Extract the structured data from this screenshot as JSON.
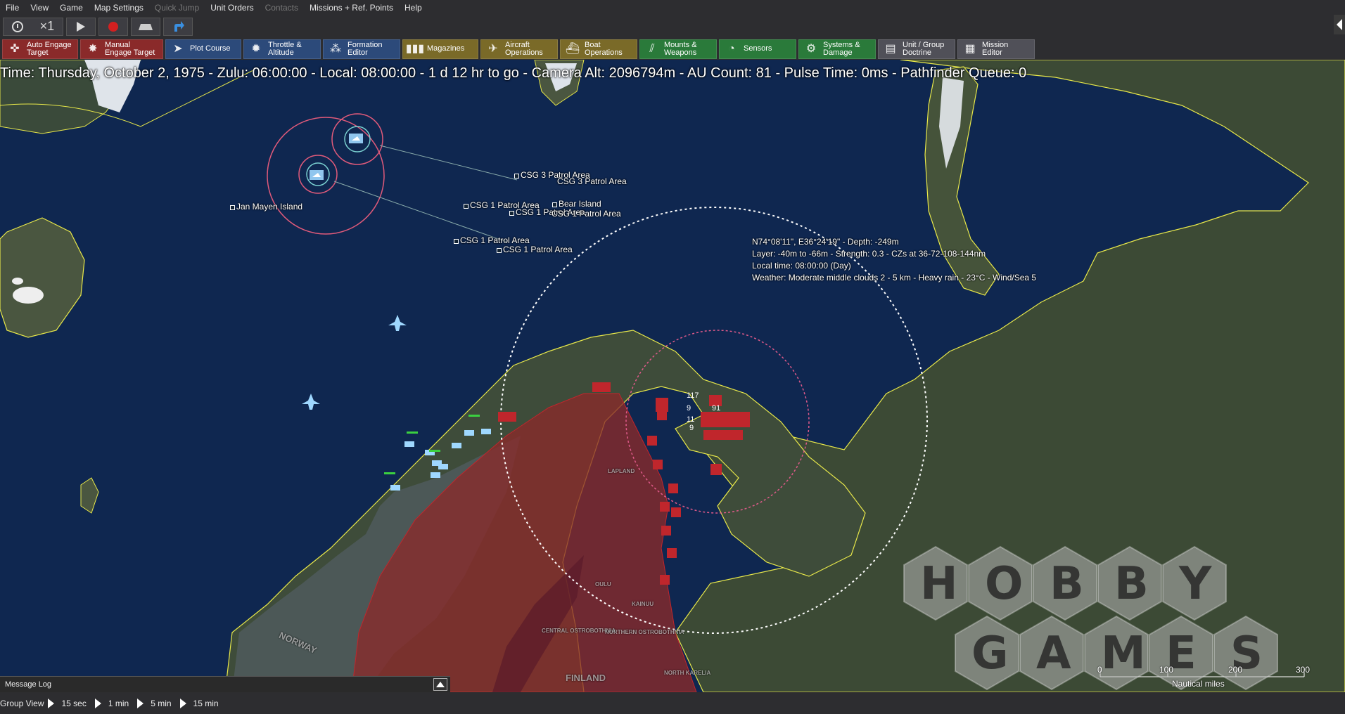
{
  "menu": [
    {
      "label": "File",
      "disabled": false
    },
    {
      "label": "View",
      "disabled": false
    },
    {
      "label": "Game",
      "disabled": false
    },
    {
      "label": "Map Settings",
      "disabled": false
    },
    {
      "label": "Quick Jump",
      "disabled": true
    },
    {
      "label": "Unit Orders",
      "disabled": false
    },
    {
      "label": "Contacts",
      "disabled": true
    },
    {
      "label": "Missions + Ref. Points",
      "disabled": false
    },
    {
      "label": "Help",
      "disabled": false
    }
  ],
  "time_controls": {
    "speed_label": "×1",
    "icons": [
      "clock-icon",
      "play-icon",
      "record-icon",
      "ship-view-icon",
      "jump-icon"
    ]
  },
  "ribbon": [
    {
      "line1": "Auto Engage",
      "line2": "Target",
      "style": "red",
      "icon": "crosshair-icon"
    },
    {
      "line1": "Manual",
      "line2": "Engage Target",
      "style": "red",
      "icon": "burst-icon"
    },
    {
      "line1": "Plot Course",
      "line2": "",
      "style": "blue",
      "icon": "compass-icon"
    },
    {
      "line1": "Throttle &",
      "line2": "Altitude",
      "style": "blue",
      "icon": "gauge-icon"
    },
    {
      "line1": "Formation",
      "line2": "Editor",
      "style": "blue",
      "icon": "formation-icon"
    },
    {
      "line1": "Magazines",
      "line2": "",
      "style": "olive",
      "icon": "ammo-icon"
    },
    {
      "line1": "Aircraft",
      "line2": "Operations",
      "style": "olive",
      "icon": "aircraft-icon"
    },
    {
      "line1": "Boat",
      "line2": "Operations",
      "style": "olive",
      "icon": "boat-icon"
    },
    {
      "line1": "Mounts &",
      "line2": "Weapons",
      "style": "green",
      "icon": "weapons-icon"
    },
    {
      "line1": "Sensors",
      "line2": "",
      "style": "green",
      "icon": "radar-icon"
    },
    {
      "line1": "Systems &",
      "line2": "Damage",
      "style": "green",
      "icon": "gear-icon"
    },
    {
      "line1": "Unit / Group",
      "line2": "Doctrine",
      "style": "gray",
      "icon": "doctrine-icon"
    },
    {
      "line1": "Mission",
      "line2": "Editor",
      "style": "gray",
      "icon": "mission-icon"
    }
  ],
  "status_line": "Time: Thursday, October 2, 1975 - Zulu: 06:00:00 - Local: 08:00:00 - 1 d 12 hr to go -  Camera Alt: 2096794m  - AU Count: 81 - Pulse Time: 0ms - Pathfinder Queue: 0",
  "map_labels": [
    {
      "text": "CSG 3 Patrol Area",
      "marker": true
    },
    {
      "text": "CSG 3 Patrol Area",
      "marker": false
    },
    {
      "text": "CSG 1 Patrol Area",
      "marker": true
    },
    {
      "text": "Bear Island",
      "marker": true
    },
    {
      "text": "CSG 1 Patrol Area",
      "marker": true
    },
    {
      "text": "CSG 1 Patrol Area",
      "marker": false
    },
    {
      "text": "CSG 1 Patrol Area",
      "marker": true
    },
    {
      "text": "CSG 1 Patrol Area",
      "marker": true
    },
    {
      "text": "Jan Mayen Island",
      "marker": true
    }
  ],
  "info": {
    "line1": "N74°08'11\", E36°24'19\" - Depth: -249m",
    "line2": "Layer: -40m to -66m - Strength: 0.3 - CZs at 36-72-108-144nm",
    "line3": "Local time: 08:00:00 (Day)",
    "line4": "Weather: Moderate middle clouds 2 - 5 km - Heavy rain - 23°C - Wind/Sea 5"
  },
  "geo_labels": [
    "NORWAY",
    "FINLAND",
    "LAPLAND",
    "OULU",
    "KAINUU",
    "NORTHERN OSTROBOTHNIA",
    "CENTRAL OSTROBOTHNIA",
    "NORTH KARELIA"
  ],
  "watermark": {
    "row1": [
      "H",
      "O",
      "B",
      "B",
      "Y"
    ],
    "row2": [
      "G",
      "A",
      "M",
      "E",
      "S"
    ]
  },
  "scale": {
    "ticks": [
      "0",
      "100",
      "200",
      "300"
    ],
    "unit": "Nautical miles"
  },
  "message_log": {
    "label": "Message Log"
  },
  "bottom": {
    "label": "Group View",
    "steps": [
      "15 sec",
      "1 min",
      "5 min",
      "15 min"
    ]
  },
  "colors": {
    "ocean": "#0f2750",
    "coastline": "#e8e84a",
    "hostile": "#c0262c",
    "friendly": "#8fd0ff"
  }
}
